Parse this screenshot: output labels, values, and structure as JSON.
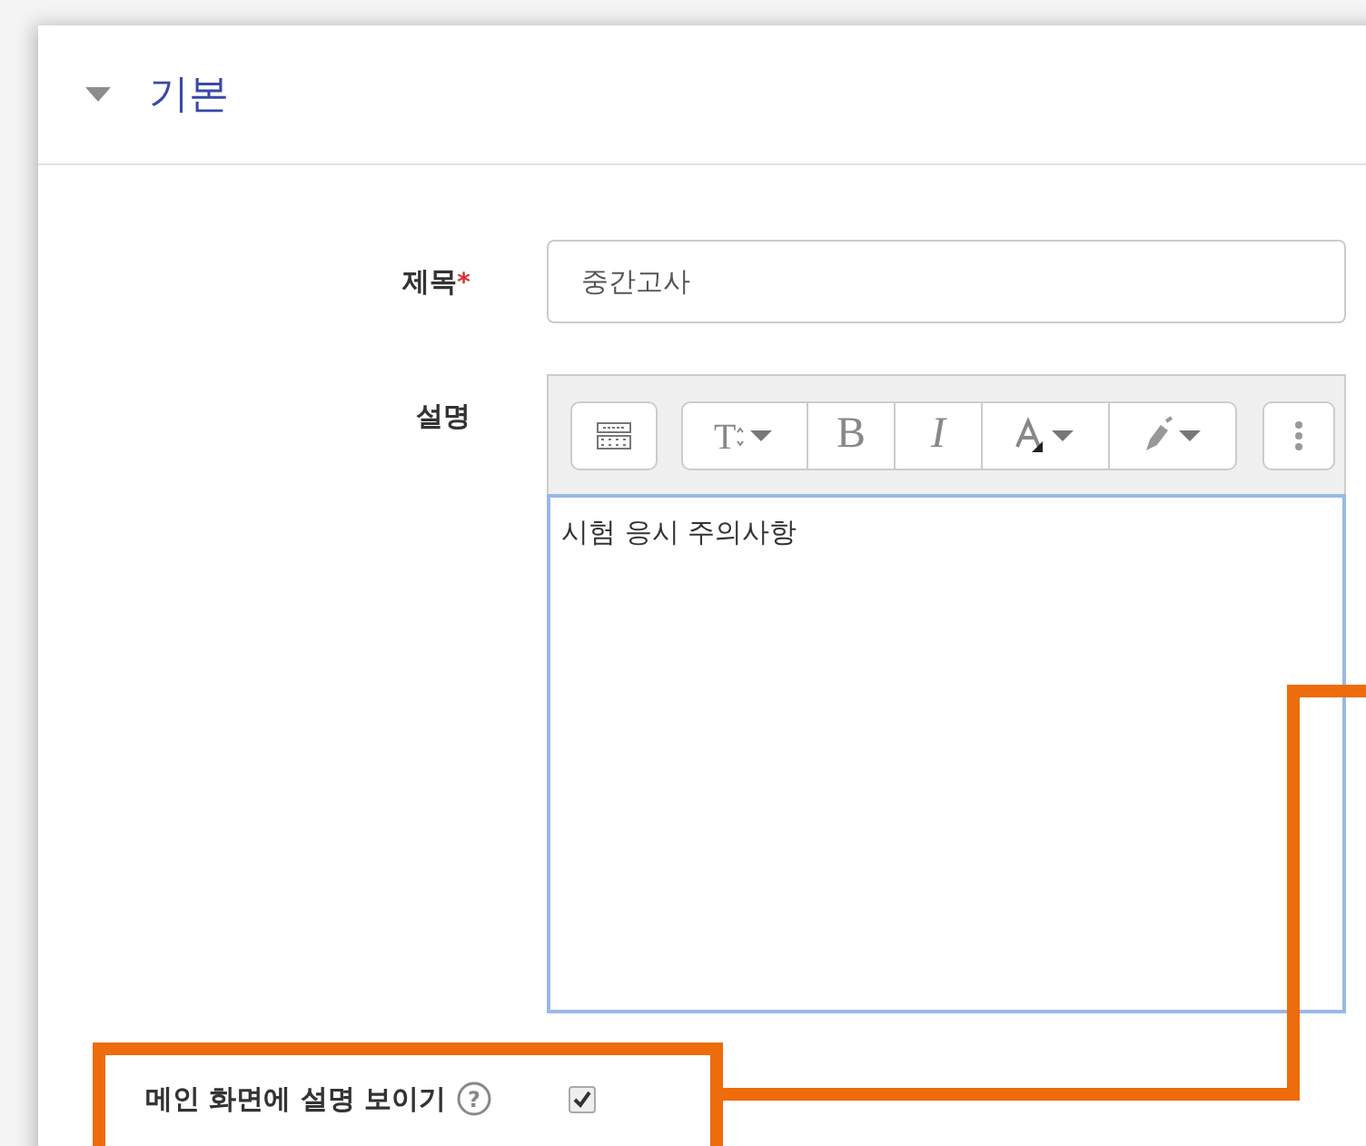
{
  "section": {
    "title": "기본",
    "expanded": true
  },
  "title_field": {
    "label": "제목",
    "required_mark": "*",
    "value": "중간고사"
  },
  "description": {
    "label": "설명",
    "toolbar": [
      {
        "kind": "keyboard"
      },
      {
        "kind": "fontsize",
        "text": "T"
      },
      {
        "kind": "text",
        "text": "B"
      },
      {
        "kind": "italic",
        "text": "I"
      },
      {
        "kind": "color"
      },
      {
        "kind": "highlight"
      },
      {
        "kind": "more"
      }
    ],
    "content": "시험 응시 주의사항"
  },
  "show_description": {
    "label": "메인 화면에 설명 보이기",
    "help": "?",
    "checked": true
  }
}
